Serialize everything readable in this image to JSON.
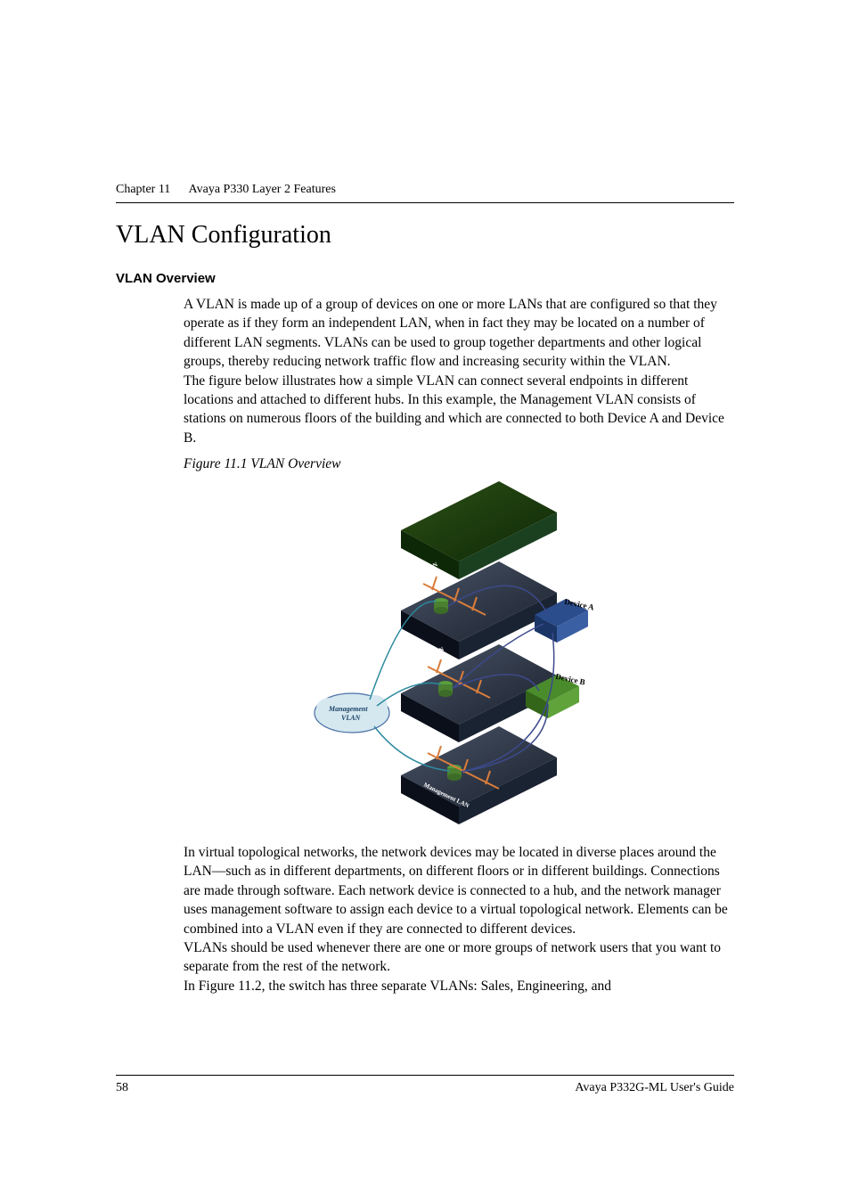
{
  "header": {
    "chapter_label": "Chapter 11",
    "chapter_title": "Avaya P330 Layer 2 Features"
  },
  "section": {
    "title": "VLAN Configuration",
    "subsection_title": "VLAN Overview",
    "paragraph1": "A VLAN is made up of a group of devices on one or more LANs that are configured so that they operate as if they form an independent LAN, when in fact they may be located on a number of different LAN segments. VLANs can be used to group together departments and other logical groups, thereby reducing network traffic flow and increasing security within the VLAN.",
    "paragraph2": "The figure below illustrates how a simple VLAN can connect several endpoints in different locations and attached to different hubs. In this example, the Management VLAN consists of stations on numerous floors of the building and which are connected to both Device A and Device B.",
    "figure_caption": "Figure 11.1    VLAN Overview",
    "figure_labels": {
      "rd_lan_top": "R&D LAN",
      "device_a": "Device A",
      "rd_lan_mid": "R&D LAN",
      "device_b": "Device B",
      "management_vlan": "Management VLAN",
      "management_lan": "Management LAN"
    },
    "paragraph3": "In virtual topological networks, the network devices may be located in diverse places around the LAN—such as in different departments, on different floors or in different buildings. Connections are made through software. Each network device is connected to a hub, and the network manager uses management software to assign each device to a virtual topological network. Elements can be combined into a VLAN even if they are connected to different devices.",
    "paragraph4": "VLANs should be used whenever there are one or more groups of network users that you want to separate from the rest of the network.",
    "paragraph5": "In Figure 11.2, the switch has three separate VLANs: Sales, Engineering, and"
  },
  "footer": {
    "page_number": "58",
    "guide_title": "Avaya P332G-ML User's Guide"
  }
}
